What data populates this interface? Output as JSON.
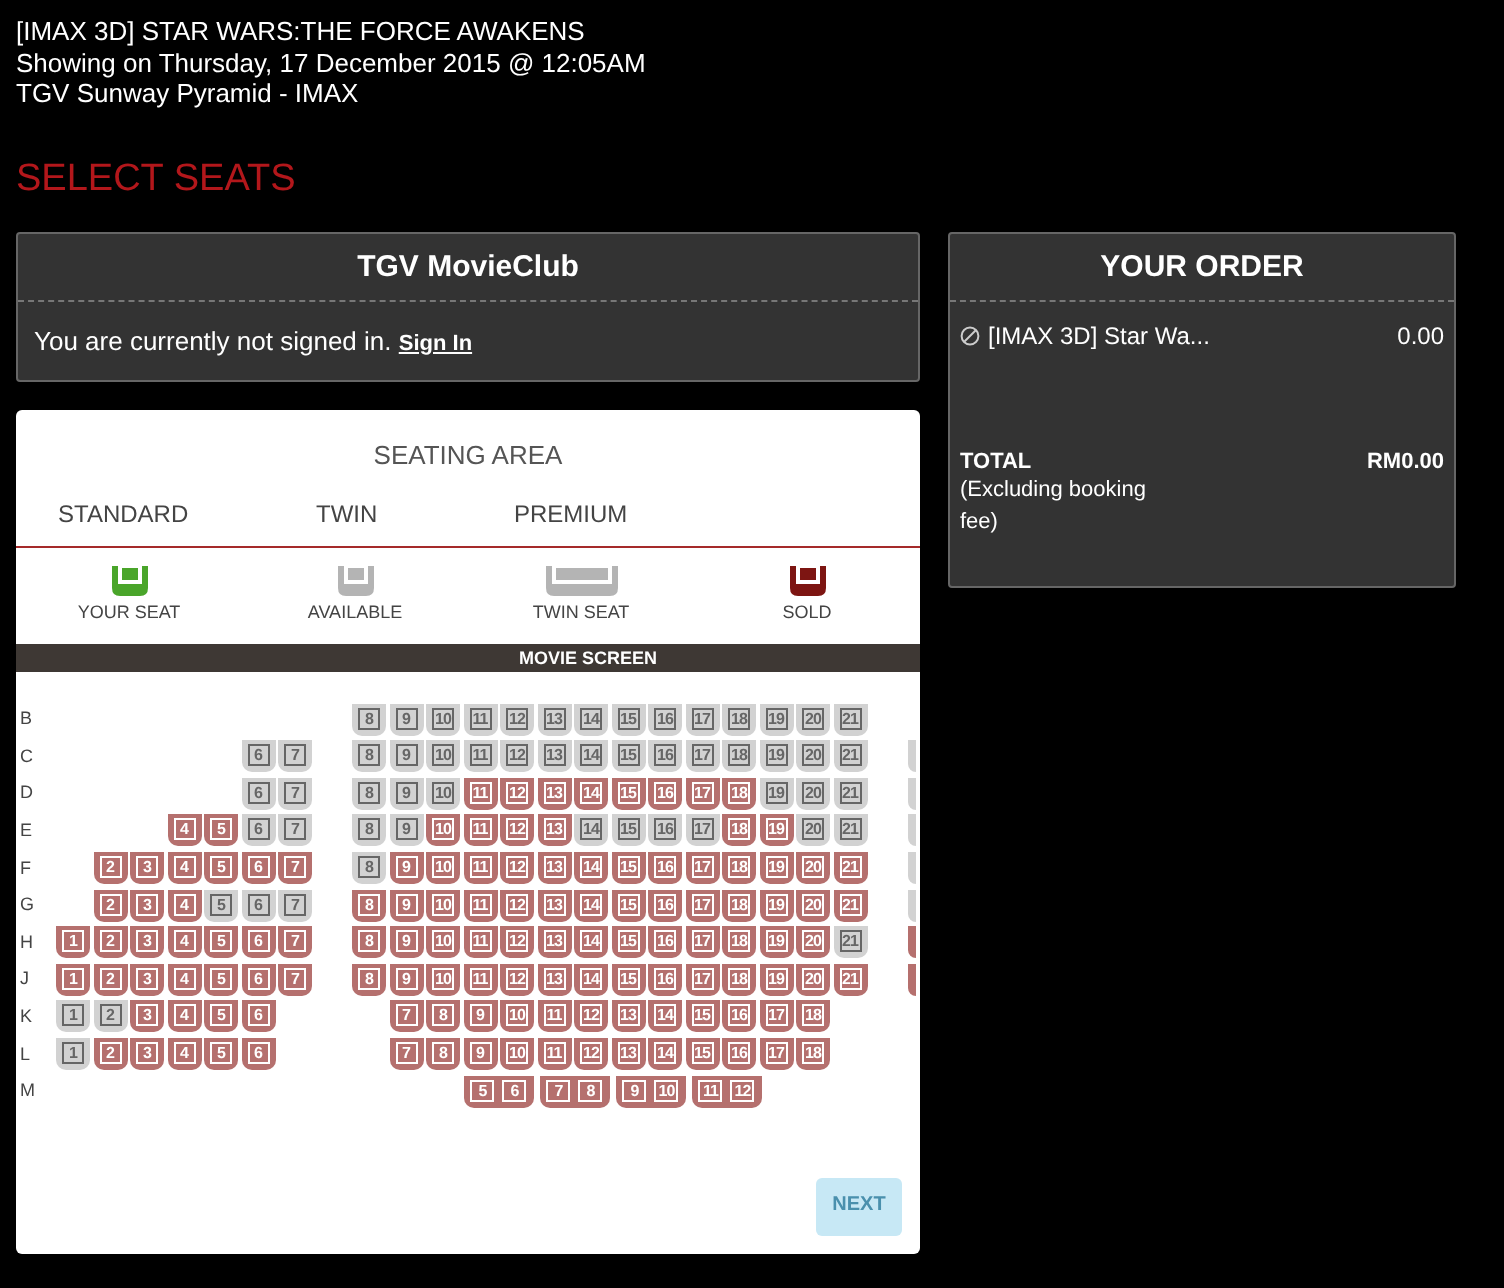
{
  "header": {
    "title": "[IMAX 3D] STAR WARS:THE FORCE AWAKENS",
    "showing": "Showing on Thursday, 17 December 2015 @ 12:05AM",
    "venue": "TGV Sunway Pyramid - IMAX"
  },
  "page_title": "SELECT SEATS",
  "movieclub": {
    "title": "TGV MovieClub",
    "message": "You are currently not signed in.",
    "link": "Sign In"
  },
  "seating": {
    "title": "SEATING AREA",
    "tabs": [
      {
        "label": "STANDARD"
      },
      {
        "label": "TWIN"
      },
      {
        "label": "PREMIUM"
      }
    ],
    "legend": [
      {
        "kind": "single",
        "label": "YOUR SEAT",
        "color": "#4aa52a"
      },
      {
        "kind": "single",
        "label": "AVAILABLE",
        "color": "#b4b4b4"
      },
      {
        "kind": "twin",
        "label": "TWIN SEAT",
        "color": "#b4b4b4"
      },
      {
        "kind": "single",
        "label": "SOLD",
        "color": "#7d1512"
      }
    ],
    "screen": "MOVIE SCREEN",
    "rows": [
      {
        "label": "B",
        "seats": [
          {
            "kind": "space"
          },
          {
            "kind": "space"
          },
          {
            "kind": "space"
          },
          {
            "kind": "space"
          },
          {
            "kind": "space"
          },
          {
            "kind": "space"
          },
          {
            "kind": "space"
          },
          {
            "kind": "space"
          },
          {
            "kind": "seat",
            "label": "8",
            "sold": false
          },
          {
            "kind": "seat",
            "label": "9",
            "sold": false
          },
          {
            "kind": "seat",
            "label": "10",
            "sold": false
          },
          {
            "kind": "seat",
            "label": "11",
            "sold": false
          },
          {
            "kind": "seat",
            "label": "12",
            "sold": false
          },
          {
            "kind": "seat",
            "label": "13",
            "sold": false
          },
          {
            "kind": "seat",
            "label": "14",
            "sold": false
          },
          {
            "kind": "seat",
            "label": "15",
            "sold": false
          },
          {
            "kind": "seat",
            "label": "16",
            "sold": false
          },
          {
            "kind": "seat",
            "label": "17",
            "sold": false
          },
          {
            "kind": "seat",
            "label": "18",
            "sold": false
          },
          {
            "kind": "seat",
            "label": "19",
            "sold": false
          },
          {
            "kind": "seat",
            "label": "20",
            "sold": false
          },
          {
            "kind": "seat",
            "label": "21",
            "sold": false
          }
        ]
      },
      {
        "label": "C",
        "seats": [
          {
            "kind": "space"
          },
          {
            "kind": "space"
          },
          {
            "kind": "space"
          },
          {
            "kind": "space"
          },
          {
            "kind": "space"
          },
          {
            "kind": "seat",
            "label": "6",
            "sold": false
          },
          {
            "kind": "seat",
            "label": "7",
            "sold": false
          },
          {
            "kind": "space"
          },
          {
            "kind": "seat",
            "label": "8",
            "sold": false
          },
          {
            "kind": "seat",
            "label": "9",
            "sold": false
          },
          {
            "kind": "seat",
            "label": "10",
            "sold": false
          },
          {
            "kind": "seat",
            "label": "11",
            "sold": false
          },
          {
            "kind": "seat",
            "label": "12",
            "sold": false
          },
          {
            "kind": "seat",
            "label": "13",
            "sold": false
          },
          {
            "kind": "seat",
            "label": "14",
            "sold": false
          },
          {
            "kind": "seat",
            "label": "15",
            "sold": false
          },
          {
            "kind": "seat",
            "label": "16",
            "sold": false
          },
          {
            "kind": "seat",
            "label": "17",
            "sold": false
          },
          {
            "kind": "seat",
            "label": "18",
            "sold": false
          },
          {
            "kind": "seat",
            "label": "19",
            "sold": false
          },
          {
            "kind": "seat",
            "label": "20",
            "sold": false
          },
          {
            "kind": "seat",
            "label": "21",
            "sold": false
          },
          {
            "kind": "space"
          },
          {
            "kind": "edge",
            "sold": false
          }
        ]
      },
      {
        "label": "D",
        "seats": [
          {
            "kind": "space"
          },
          {
            "kind": "space"
          },
          {
            "kind": "space"
          },
          {
            "kind": "space"
          },
          {
            "kind": "space"
          },
          {
            "kind": "seat",
            "label": "6",
            "sold": false
          },
          {
            "kind": "seat",
            "label": "7",
            "sold": false
          },
          {
            "kind": "space"
          },
          {
            "kind": "seat",
            "label": "8",
            "sold": false
          },
          {
            "kind": "seat",
            "label": "9",
            "sold": false
          },
          {
            "kind": "seat",
            "label": "10",
            "sold": false
          },
          {
            "kind": "seat",
            "label": "11",
            "sold": true
          },
          {
            "kind": "seat",
            "label": "12",
            "sold": true
          },
          {
            "kind": "seat",
            "label": "13",
            "sold": true
          },
          {
            "kind": "seat",
            "label": "14",
            "sold": true
          },
          {
            "kind": "seat",
            "label": "15",
            "sold": true
          },
          {
            "kind": "seat",
            "label": "16",
            "sold": true
          },
          {
            "kind": "seat",
            "label": "17",
            "sold": true
          },
          {
            "kind": "seat",
            "label": "18",
            "sold": true
          },
          {
            "kind": "seat",
            "label": "19",
            "sold": false
          },
          {
            "kind": "seat",
            "label": "20",
            "sold": false
          },
          {
            "kind": "seat",
            "label": "21",
            "sold": false
          },
          {
            "kind": "space"
          },
          {
            "kind": "edge",
            "sold": false
          }
        ]
      },
      {
        "label": "E",
        "seats": [
          {
            "kind": "space"
          },
          {
            "kind": "space"
          },
          {
            "kind": "space"
          },
          {
            "kind": "seat",
            "label": "4",
            "sold": true
          },
          {
            "kind": "seat",
            "label": "5",
            "sold": true
          },
          {
            "kind": "seat",
            "label": "6",
            "sold": false
          },
          {
            "kind": "seat",
            "label": "7",
            "sold": false
          },
          {
            "kind": "space"
          },
          {
            "kind": "seat",
            "label": "8",
            "sold": false
          },
          {
            "kind": "seat",
            "label": "9",
            "sold": false
          },
          {
            "kind": "seat",
            "label": "10",
            "sold": true
          },
          {
            "kind": "seat",
            "label": "11",
            "sold": true
          },
          {
            "kind": "seat",
            "label": "12",
            "sold": true
          },
          {
            "kind": "seat",
            "label": "13",
            "sold": true
          },
          {
            "kind": "seat",
            "label": "14",
            "sold": false
          },
          {
            "kind": "seat",
            "label": "15",
            "sold": false
          },
          {
            "kind": "seat",
            "label": "16",
            "sold": false
          },
          {
            "kind": "seat",
            "label": "17",
            "sold": false
          },
          {
            "kind": "seat",
            "label": "18",
            "sold": true
          },
          {
            "kind": "seat",
            "label": "19",
            "sold": true
          },
          {
            "kind": "seat",
            "label": "20",
            "sold": false
          },
          {
            "kind": "seat",
            "label": "21",
            "sold": false
          },
          {
            "kind": "space"
          },
          {
            "kind": "edge",
            "sold": false
          }
        ]
      },
      {
        "label": "F",
        "seats": [
          {
            "kind": "space"
          },
          {
            "kind": "seat",
            "label": "2",
            "sold": true
          },
          {
            "kind": "seat",
            "label": "3",
            "sold": true
          },
          {
            "kind": "seat",
            "label": "4",
            "sold": true
          },
          {
            "kind": "seat",
            "label": "5",
            "sold": true
          },
          {
            "kind": "seat",
            "label": "6",
            "sold": true
          },
          {
            "kind": "seat",
            "label": "7",
            "sold": true
          },
          {
            "kind": "space"
          },
          {
            "kind": "seat",
            "label": "8",
            "sold": false
          },
          {
            "kind": "seat",
            "label": "9",
            "sold": true
          },
          {
            "kind": "seat",
            "label": "10",
            "sold": true
          },
          {
            "kind": "seat",
            "label": "11",
            "sold": true
          },
          {
            "kind": "seat",
            "label": "12",
            "sold": true
          },
          {
            "kind": "seat",
            "label": "13",
            "sold": true
          },
          {
            "kind": "seat",
            "label": "14",
            "sold": true
          },
          {
            "kind": "seat",
            "label": "15",
            "sold": true
          },
          {
            "kind": "seat",
            "label": "16",
            "sold": true
          },
          {
            "kind": "seat",
            "label": "17",
            "sold": true
          },
          {
            "kind": "seat",
            "label": "18",
            "sold": true
          },
          {
            "kind": "seat",
            "label": "19",
            "sold": true
          },
          {
            "kind": "seat",
            "label": "20",
            "sold": true
          },
          {
            "kind": "seat",
            "label": "21",
            "sold": true
          },
          {
            "kind": "space"
          },
          {
            "kind": "edge",
            "sold": false
          }
        ]
      },
      {
        "label": "G",
        "seats": [
          {
            "kind": "space"
          },
          {
            "kind": "seat",
            "label": "2",
            "sold": true
          },
          {
            "kind": "seat",
            "label": "3",
            "sold": true
          },
          {
            "kind": "seat",
            "label": "4",
            "sold": true
          },
          {
            "kind": "seat",
            "label": "5",
            "sold": false
          },
          {
            "kind": "seat",
            "label": "6",
            "sold": false
          },
          {
            "kind": "seat",
            "label": "7",
            "sold": false
          },
          {
            "kind": "space"
          },
          {
            "kind": "seat",
            "label": "8",
            "sold": true
          },
          {
            "kind": "seat",
            "label": "9",
            "sold": true
          },
          {
            "kind": "seat",
            "label": "10",
            "sold": true
          },
          {
            "kind": "seat",
            "label": "11",
            "sold": true
          },
          {
            "kind": "seat",
            "label": "12",
            "sold": true
          },
          {
            "kind": "seat",
            "label": "13",
            "sold": true
          },
          {
            "kind": "seat",
            "label": "14",
            "sold": true
          },
          {
            "kind": "seat",
            "label": "15",
            "sold": true
          },
          {
            "kind": "seat",
            "label": "16",
            "sold": true
          },
          {
            "kind": "seat",
            "label": "17",
            "sold": true
          },
          {
            "kind": "seat",
            "label": "18",
            "sold": true
          },
          {
            "kind": "seat",
            "label": "19",
            "sold": true
          },
          {
            "kind": "seat",
            "label": "20",
            "sold": true
          },
          {
            "kind": "seat",
            "label": "21",
            "sold": true
          },
          {
            "kind": "space"
          },
          {
            "kind": "edge",
            "sold": false
          }
        ]
      },
      {
        "label": "H",
        "seats": [
          {
            "kind": "seat",
            "label": "1",
            "sold": true
          },
          {
            "kind": "seat",
            "label": "2",
            "sold": true
          },
          {
            "kind": "seat",
            "label": "3",
            "sold": true
          },
          {
            "kind": "seat",
            "label": "4",
            "sold": true
          },
          {
            "kind": "seat",
            "label": "5",
            "sold": true
          },
          {
            "kind": "seat",
            "label": "6",
            "sold": true
          },
          {
            "kind": "seat",
            "label": "7",
            "sold": true
          },
          {
            "kind": "space"
          },
          {
            "kind": "seat",
            "label": "8",
            "sold": true
          },
          {
            "kind": "seat",
            "label": "9",
            "sold": true
          },
          {
            "kind": "seat",
            "label": "10",
            "sold": true
          },
          {
            "kind": "seat",
            "label": "11",
            "sold": true
          },
          {
            "kind": "seat",
            "label": "12",
            "sold": true
          },
          {
            "kind": "seat",
            "label": "13",
            "sold": true
          },
          {
            "kind": "seat",
            "label": "14",
            "sold": true
          },
          {
            "kind": "seat",
            "label": "15",
            "sold": true
          },
          {
            "kind": "seat",
            "label": "16",
            "sold": true
          },
          {
            "kind": "seat",
            "label": "17",
            "sold": true
          },
          {
            "kind": "seat",
            "label": "18",
            "sold": true
          },
          {
            "kind": "seat",
            "label": "19",
            "sold": true
          },
          {
            "kind": "seat",
            "label": "20",
            "sold": true
          },
          {
            "kind": "seat",
            "label": "21",
            "sold": false
          },
          {
            "kind": "space"
          },
          {
            "kind": "edge",
            "sold": true
          }
        ]
      },
      {
        "label": "J",
        "seats": [
          {
            "kind": "seat",
            "label": "1",
            "sold": true
          },
          {
            "kind": "seat",
            "label": "2",
            "sold": true
          },
          {
            "kind": "seat",
            "label": "3",
            "sold": true
          },
          {
            "kind": "seat",
            "label": "4",
            "sold": true
          },
          {
            "kind": "seat",
            "label": "5",
            "sold": true
          },
          {
            "kind": "seat",
            "label": "6",
            "sold": true
          },
          {
            "kind": "seat",
            "label": "7",
            "sold": true
          },
          {
            "kind": "space"
          },
          {
            "kind": "seat",
            "label": "8",
            "sold": true
          },
          {
            "kind": "seat",
            "label": "9",
            "sold": true
          },
          {
            "kind": "seat",
            "label": "10",
            "sold": true
          },
          {
            "kind": "seat",
            "label": "11",
            "sold": true
          },
          {
            "kind": "seat",
            "label": "12",
            "sold": true
          },
          {
            "kind": "seat",
            "label": "13",
            "sold": true
          },
          {
            "kind": "seat",
            "label": "14",
            "sold": true
          },
          {
            "kind": "seat",
            "label": "15",
            "sold": true
          },
          {
            "kind": "seat",
            "label": "16",
            "sold": true
          },
          {
            "kind": "seat",
            "label": "17",
            "sold": true
          },
          {
            "kind": "seat",
            "label": "18",
            "sold": true
          },
          {
            "kind": "seat",
            "label": "19",
            "sold": true
          },
          {
            "kind": "seat",
            "label": "20",
            "sold": true
          },
          {
            "kind": "seat",
            "label": "21",
            "sold": true
          },
          {
            "kind": "space"
          },
          {
            "kind": "edge",
            "sold": true
          }
        ]
      },
      {
        "label": "K",
        "seats": [
          {
            "kind": "seat",
            "label": "1",
            "sold": false
          },
          {
            "kind": "seat",
            "label": "2",
            "sold": false
          },
          {
            "kind": "seat",
            "label": "3",
            "sold": true
          },
          {
            "kind": "seat",
            "label": "4",
            "sold": true
          },
          {
            "kind": "seat",
            "label": "5",
            "sold": true
          },
          {
            "kind": "seat",
            "label": "6",
            "sold": true
          },
          {
            "kind": "space"
          },
          {
            "kind": "space"
          },
          {
            "kind": "space"
          },
          {
            "kind": "seat",
            "label": "7",
            "sold": true
          },
          {
            "kind": "seat",
            "label": "8",
            "sold": true
          },
          {
            "kind": "seat",
            "label": "9",
            "sold": true
          },
          {
            "kind": "seat",
            "label": "10",
            "sold": true
          },
          {
            "kind": "seat",
            "label": "11",
            "sold": true
          },
          {
            "kind": "seat",
            "label": "12",
            "sold": true
          },
          {
            "kind": "seat",
            "label": "13",
            "sold": true
          },
          {
            "kind": "seat",
            "label": "14",
            "sold": true
          },
          {
            "kind": "seat",
            "label": "15",
            "sold": true
          },
          {
            "kind": "seat",
            "label": "16",
            "sold": true
          },
          {
            "kind": "seat",
            "label": "17",
            "sold": true
          },
          {
            "kind": "seat",
            "label": "18",
            "sold": true
          }
        ]
      },
      {
        "label": "L",
        "seats": [
          {
            "kind": "seat",
            "label": "1",
            "sold": false
          },
          {
            "kind": "seat",
            "label": "2",
            "sold": true
          },
          {
            "kind": "seat",
            "label": "3",
            "sold": true
          },
          {
            "kind": "seat",
            "label": "4",
            "sold": true
          },
          {
            "kind": "seat",
            "label": "5",
            "sold": true
          },
          {
            "kind": "seat",
            "label": "6",
            "sold": true
          },
          {
            "kind": "space"
          },
          {
            "kind": "space"
          },
          {
            "kind": "space"
          },
          {
            "kind": "seat",
            "label": "7",
            "sold": true
          },
          {
            "kind": "seat",
            "label": "8",
            "sold": true
          },
          {
            "kind": "seat",
            "label": "9",
            "sold": true
          },
          {
            "kind": "seat",
            "label": "10",
            "sold": true
          },
          {
            "kind": "seat",
            "label": "11",
            "sold": true
          },
          {
            "kind": "seat",
            "label": "12",
            "sold": true
          },
          {
            "kind": "seat",
            "label": "13",
            "sold": true
          },
          {
            "kind": "seat",
            "label": "14",
            "sold": true
          },
          {
            "kind": "seat",
            "label": "15",
            "sold": true
          },
          {
            "kind": "seat",
            "label": "16",
            "sold": true
          },
          {
            "kind": "seat",
            "label": "17",
            "sold": true
          },
          {
            "kind": "seat",
            "label": "18",
            "sold": true
          }
        ]
      },
      {
        "label": "M",
        "seats": [
          {
            "kind": "space"
          },
          {
            "kind": "space"
          },
          {
            "kind": "space"
          },
          {
            "kind": "space"
          },
          {
            "kind": "space"
          },
          {
            "kind": "space"
          },
          {
            "kind": "space"
          },
          {
            "kind": "space"
          },
          {
            "kind": "space"
          },
          {
            "kind": "space"
          },
          {
            "kind": "space"
          },
          {
            "kind": "twin",
            "labels": [
              "5",
              "6"
            ],
            "sold": true
          },
          {
            "kind": "twin",
            "labels": [
              "7",
              "8"
            ],
            "sold": true
          },
          {
            "kind": "twin",
            "labels": [
              "9",
              "10"
            ],
            "sold": true
          },
          {
            "kind": "twin",
            "labels": [
              "11",
              "12"
            ],
            "sold": true
          }
        ]
      }
    ],
    "next": {
      "label": "NEXT",
      "disabled": true
    }
  },
  "order": {
    "title": "YOUR ORDER",
    "items": [
      {
        "name": "[IMAX 3D] Star Wa...",
        "price": "0.00"
      }
    ],
    "total_label": "TOTAL",
    "total_note": "(Excluding booking fee)",
    "total": "RM0.00"
  }
}
